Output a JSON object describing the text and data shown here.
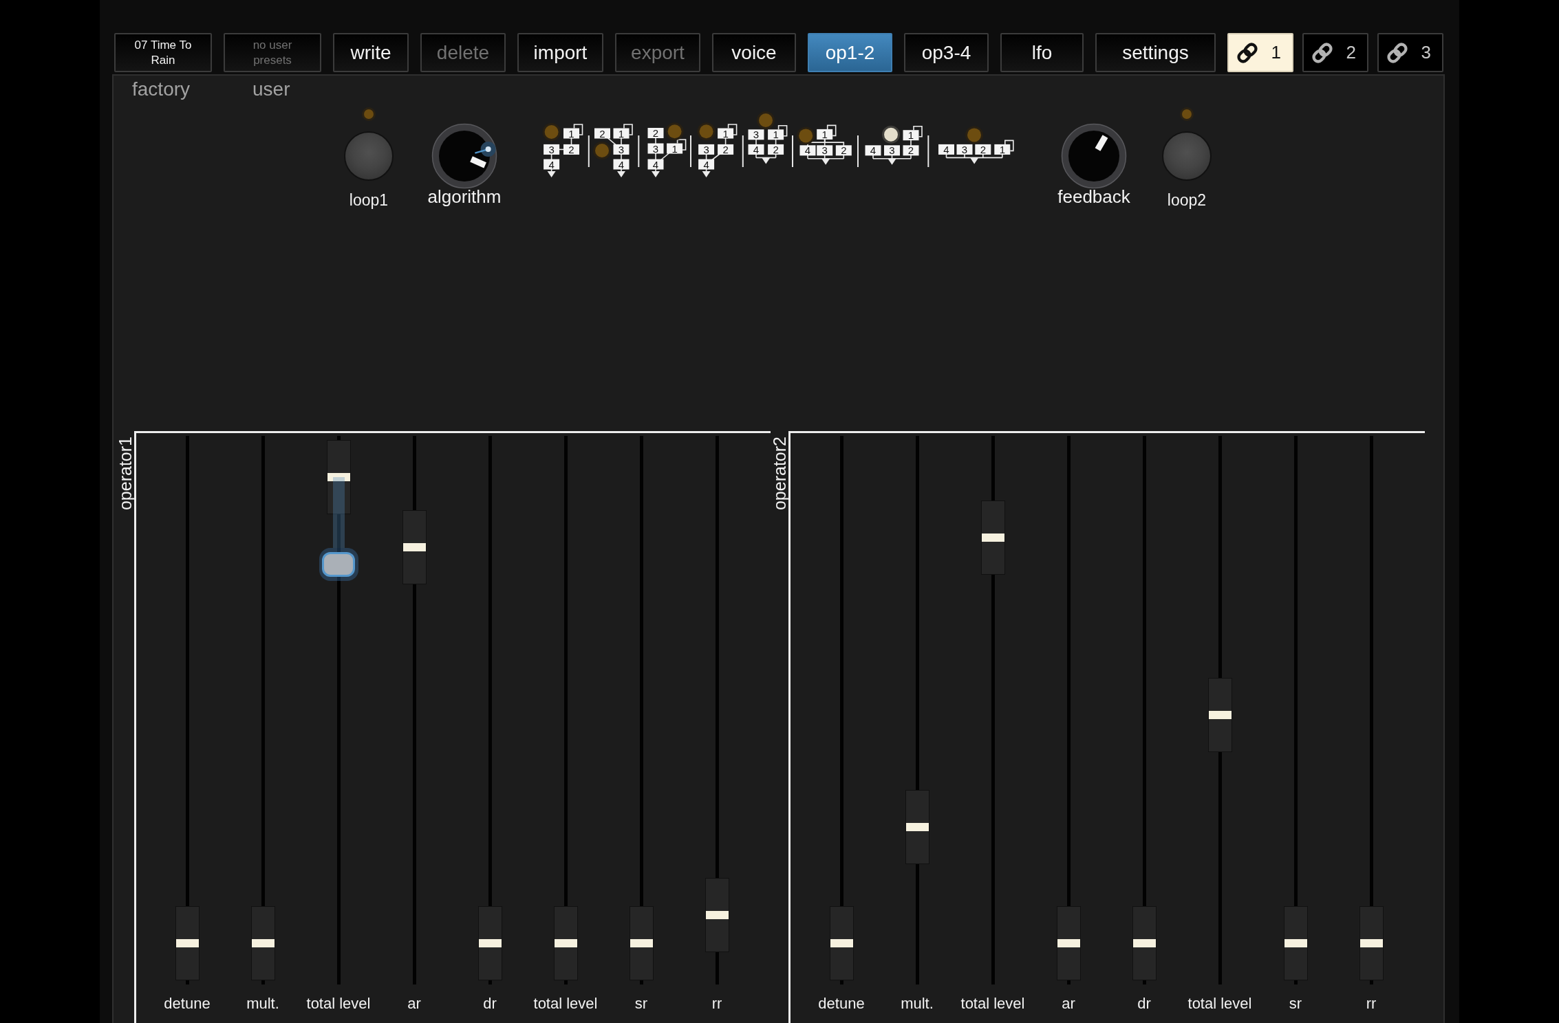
{
  "toolbar": {
    "presets": [
      {
        "label": "07 Time To Rain",
        "disabled": false
      },
      {
        "label": "no user presets",
        "disabled": true
      }
    ],
    "actions": [
      {
        "label": "write",
        "disabled": false
      },
      {
        "label": "delete",
        "disabled": true
      },
      {
        "label": "import",
        "disabled": false
      },
      {
        "label": "export",
        "disabled": true
      }
    ],
    "tabs": [
      {
        "label": "voice",
        "selected": false
      },
      {
        "label": "op1-2",
        "selected": true
      },
      {
        "label": "op3-4",
        "selected": false
      },
      {
        "label": "lfo",
        "selected": false
      },
      {
        "label": "settings",
        "selected": false
      }
    ],
    "links": [
      {
        "label": "1",
        "selected": true
      },
      {
        "label": "2",
        "selected": false
      },
      {
        "label": "3",
        "selected": false
      }
    ]
  },
  "preset_banks": [
    {
      "label": "factory"
    },
    {
      "label": "user"
    }
  ],
  "voice": {
    "loop1": {
      "label": "loop1",
      "on": false
    },
    "algorithm": {
      "label": "algorithm",
      "level": 0.88,
      "touched": true
    },
    "algorithms": [
      {
        "selected": false,
        "operators": [
          "1",
          "3",
          "2",
          "4"
        ]
      },
      {
        "selected": false,
        "operators": [
          "2",
          "1",
          "3",
          "4"
        ]
      },
      {
        "selected": false,
        "operators": [
          "2",
          "3",
          "1",
          "4"
        ]
      },
      {
        "selected": false,
        "operators": [
          "1",
          "3",
          "2",
          "4"
        ]
      },
      {
        "selected": false,
        "operators": [
          "3",
          "1",
          "4",
          "2"
        ]
      },
      {
        "selected": false,
        "operators": [
          "1",
          "4",
          "3",
          "2"
        ]
      },
      {
        "selected": true,
        "operators": [
          "1",
          "4",
          "3",
          "2"
        ]
      },
      {
        "selected": false,
        "operators": [
          "4",
          "3",
          "2",
          "1"
        ]
      }
    ],
    "feedback": {
      "label": "feedback",
      "level": 0.6
    },
    "loop2": {
      "label": "loop2",
      "on": false
    }
  },
  "operators": [
    {
      "label": "operator1",
      "sliders": [
        {
          "label": "detune",
          "level": 0,
          "grabbed": false
        },
        {
          "label": "mult.",
          "level": 0,
          "grabbed": false
        },
        {
          "label": "total level",
          "level": 1,
          "grabbed": true
        },
        {
          "label": "ar",
          "level": 0.85,
          "grabbed": false
        },
        {
          "label": "dr",
          "level": 0,
          "grabbed": false
        },
        {
          "label": "total level",
          "level": 0,
          "grabbed": false
        },
        {
          "label": "sr",
          "level": 0,
          "grabbed": false
        },
        {
          "label": "rr",
          "level": 0.06,
          "grabbed": false
        }
      ]
    },
    {
      "label": "operator2",
      "sliders": [
        {
          "label": "detune",
          "level": 0,
          "grabbed": false
        },
        {
          "label": "mult.",
          "level": 0.25,
          "grabbed": false
        },
        {
          "label": "total level",
          "level": 0.87,
          "grabbed": false
        },
        {
          "label": "ar",
          "level": 0,
          "grabbed": false
        },
        {
          "label": "dr",
          "level": 0,
          "grabbed": false
        },
        {
          "label": "total level",
          "level": 0.49,
          "grabbed": false
        },
        {
          "label": "sr",
          "level": 0,
          "grabbed": false
        },
        {
          "label": "rr",
          "level": 0,
          "grabbed": false
        }
      ]
    }
  ]
}
